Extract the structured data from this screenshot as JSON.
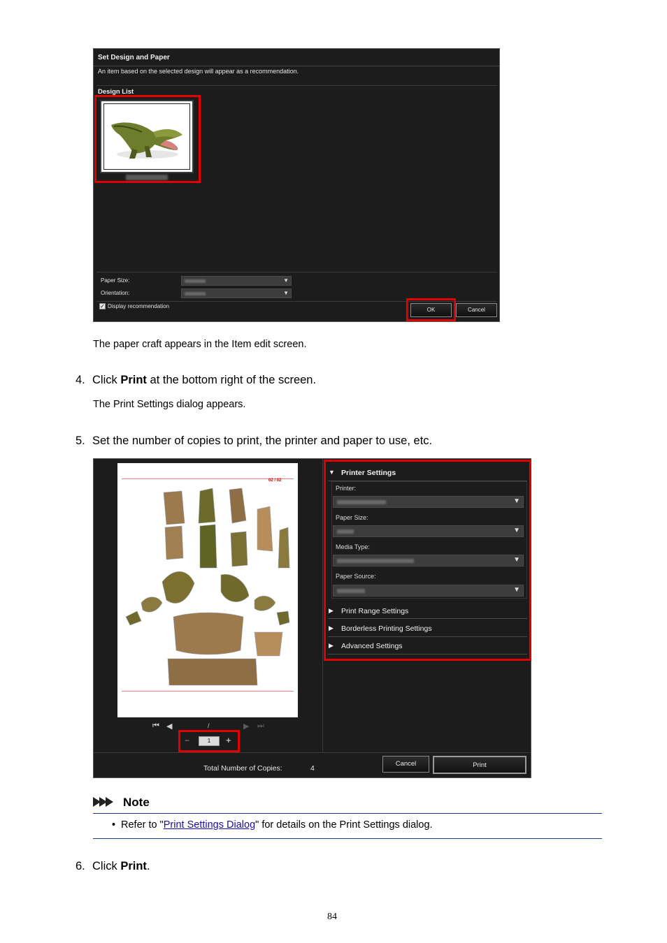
{
  "dialog_design": {
    "title": "Set Design and Paper",
    "description": "An item based on the selected design will appear as a recommendation.",
    "design_list_label": "Design List",
    "paper_size_label": "Paper Size:",
    "orientation_label": "Orientation:",
    "display_recommendation_label": "Display recommendation",
    "display_recommendation_checked": true,
    "ok_label": "OK",
    "cancel_label": "Cancel"
  },
  "text": {
    "caption_1": "The paper craft appears in the Item edit screen.",
    "step4_num": "4.",
    "step4_pre": "Click ",
    "step4_bold": "Print",
    "step4_post": " at the bottom right of the screen.",
    "step4_sub": "The Print Settings dialog appears.",
    "step5_num": "5.",
    "step5_text": "Set the number of copies to print, the printer and paper to use, etc.",
    "step6_num": "6.",
    "step6_pre": "Click ",
    "step6_bold": "Print",
    "step6_post": "."
  },
  "dialog_print": {
    "page_indicator": "02 / 02",
    "page_separator": "/",
    "copies_value": "1",
    "minus_label": "−",
    "plus_label": "+",
    "printer_settings_label": "Printer Settings",
    "printer_label": "Printer:",
    "paper_size_label": "Paper Size:",
    "media_type_label": "Media Type:",
    "paper_source_label": "Paper Source:",
    "print_range_label": "Print Range Settings",
    "borderless_label": "Borderless Printing Settings",
    "advanced_label": "Advanced Settings",
    "total_copies_label": "Total Number of Copies:",
    "total_copies_value": "4",
    "cancel_label": "Cancel",
    "print_label": "Print"
  },
  "note": {
    "heading": "Note",
    "bullet": "•",
    "pre": "Refer to \"",
    "link": "Print Settings Dialog",
    "post": "\" for details on the Print Settings dialog."
  },
  "footer": {
    "page_number": "84"
  },
  "colors": {
    "highlight": "#e10000",
    "dialog_bg": "#1c1c1c",
    "link": "#1a0dab",
    "note_rule": "#1c3d8c"
  }
}
